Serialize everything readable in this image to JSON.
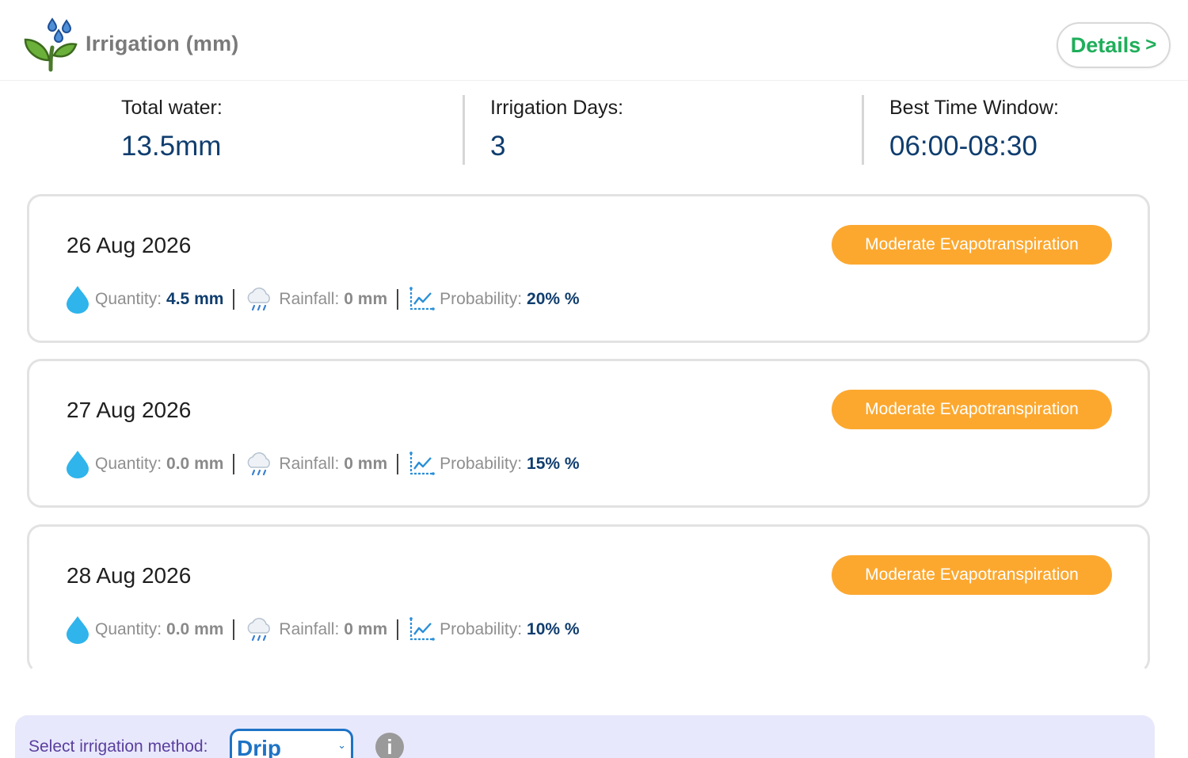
{
  "header": {
    "title": "Irrigation (mm)",
    "details_label": "Details",
    "details_chevron": ">"
  },
  "summary": {
    "total_water": {
      "label": "Total water:",
      "value": "13.5mm"
    },
    "irrigation_days": {
      "label": "Irrigation Days:",
      "value": "3"
    },
    "best_time": {
      "label": "Best Time Window:",
      "value": "06:00-08:30"
    }
  },
  "days": [
    {
      "date": "26 Aug 2026",
      "badge": "Moderate Evapotranspiration",
      "quantity_label": "Quantity:",
      "quantity_value": "4.5 mm",
      "rainfall_label": "Rainfall:",
      "rainfall_value": "0 mm",
      "probability_label": "Probability:",
      "probability_value": "20% %"
    },
    {
      "date": "27 Aug 2026",
      "badge": "Moderate Evapotranspiration",
      "quantity_label": "Quantity:",
      "quantity_value": "0.0 mm",
      "rainfall_label": "Rainfall:",
      "rainfall_value": "0 mm",
      "probability_label": "Probability:",
      "probability_value": "15% %"
    },
    {
      "date": "28 Aug 2026",
      "badge": "Moderate Evapotranspiration",
      "quantity_label": "Quantity:",
      "quantity_value": "0.0 mm",
      "rainfall_label": "Rainfall:",
      "rainfall_value": "0 mm",
      "probability_label": "Probability:",
      "probability_value": "10% %"
    }
  ],
  "method": {
    "label": "Select irrigation method:",
    "selected": "Drip",
    "info_glyph": "i"
  },
  "icons": {
    "brand": "plant-water-drops-icon",
    "quantity": "water-drop-icon",
    "rainfall": "rain-cloud-icon",
    "probability": "line-chart-icon",
    "info": "info-icon"
  },
  "colors": {
    "accent_green": "#1fae5a",
    "value_navy": "#0f3d6e",
    "badge_orange": "#fca82f",
    "select_blue": "#1e73c6",
    "method_bar_bg": "#e8e8fc"
  }
}
